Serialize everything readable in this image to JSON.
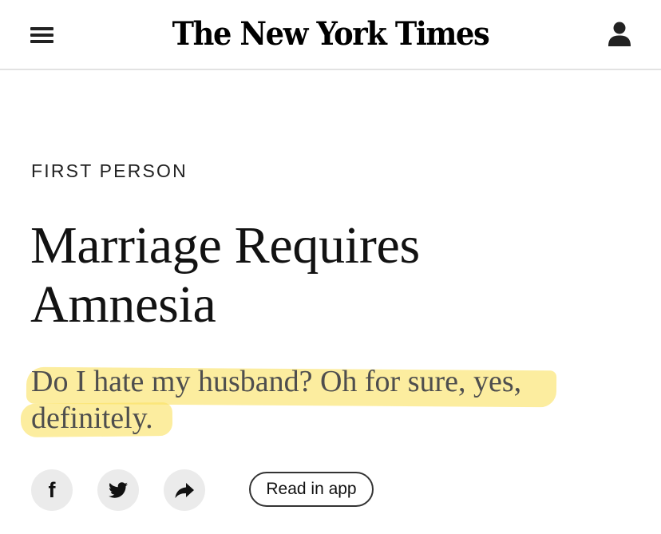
{
  "header": {
    "masthead": "The New York Times",
    "menu_icon": "hamburger-menu-icon",
    "account_icon": "user-account-icon"
  },
  "article": {
    "kicker": "FIRST PERSON",
    "headline": "Marriage Requires Amnesia",
    "subheadline": "Do I hate my husband? Oh for sure, yes, definitely."
  },
  "share": {
    "facebook_icon": "facebook-icon",
    "twitter_icon": "twitter-icon",
    "share_icon": "share-arrow-icon",
    "read_in_app_label": "Read in app"
  },
  "colors": {
    "highlight": "#fae264",
    "share_button_bg": "#ebebeb",
    "header_border": "#e2e2e2",
    "subheadline_text": "#4e4e4e"
  }
}
